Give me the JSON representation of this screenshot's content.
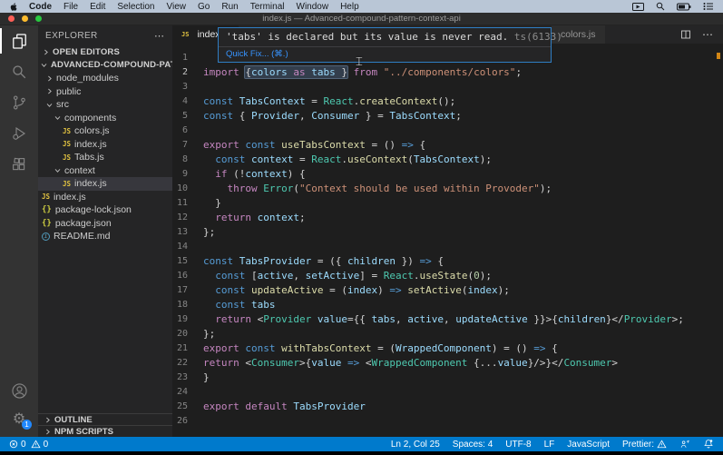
{
  "menubar": {
    "items": [
      "Code",
      "File",
      "Edit",
      "Selection",
      "View",
      "Go",
      "Run",
      "Terminal",
      "Window",
      "Help"
    ]
  },
  "window": {
    "title": "index.js — Advanced-compound-pattern-context-api"
  },
  "activity_bar": {
    "settings_badge": "1"
  },
  "sidebar": {
    "title": "EXPLORER",
    "more": "⋯",
    "open_editors_label": "OPEN EDITORS",
    "root_label": "ADVANCED-COMPOUND-PATTERN-C...",
    "tree": [
      {
        "label": "node_modules",
        "kind": "folder",
        "state": "collapsed",
        "depth": 1
      },
      {
        "label": "public",
        "kind": "folder",
        "state": "collapsed",
        "depth": 1
      },
      {
        "label": "src",
        "kind": "folder",
        "state": "expanded",
        "depth": 1
      },
      {
        "label": "components",
        "kind": "folder",
        "state": "expanded",
        "depth": 2
      },
      {
        "label": "colors.js",
        "kind": "js",
        "depth": 3
      },
      {
        "label": "index.js",
        "kind": "js",
        "depth": 3
      },
      {
        "label": "Tabs.js",
        "kind": "js",
        "depth": 3
      },
      {
        "label": "context",
        "kind": "folder",
        "state": "expanded",
        "depth": 2
      },
      {
        "label": "index.js",
        "kind": "js",
        "depth": 3,
        "selected": true
      },
      {
        "label": "index.js",
        "kind": "js",
        "depth": 1
      },
      {
        "label": "package-lock.json",
        "kind": "json",
        "depth": 1
      },
      {
        "label": "package.json",
        "kind": "json",
        "depth": 1
      },
      {
        "label": "README.md",
        "kind": "info",
        "depth": 1
      }
    ],
    "outline_label": "OUTLINE",
    "npm_label": "NPM SCRIPTS"
  },
  "editor": {
    "tabs": {
      "active": "index.js",
      "inactive": "colors.js"
    },
    "tooltip": {
      "message": "'tabs' is declared but its value is never read.",
      "code": "ts(6133)",
      "quick_fix": "Quick Fix... (⌘.)"
    },
    "lines": [
      {
        "n": 1,
        "tokens": []
      },
      {
        "n": 2,
        "active": true,
        "tokens": [
          [
            "k",
            "import "
          ],
          [
            "p",
            "{",
            "hl"
          ],
          [
            "v",
            "colors",
            "hl"
          ],
          [
            "k",
            " as ",
            "hl"
          ],
          [
            "v",
            "tabs",
            "hl"
          ],
          [
            "p",
            " }",
            "hl"
          ],
          [
            "k",
            " from "
          ],
          [
            "str",
            "\"../components/colors\""
          ],
          [
            "p",
            ";"
          ]
        ]
      },
      {
        "n": 3,
        "tokens": []
      },
      {
        "n": 4,
        "tokens": [
          [
            "s",
            "const "
          ],
          [
            "v",
            "TabsContext "
          ],
          [
            "p",
            "= "
          ],
          [
            "c",
            "React"
          ],
          [
            "p",
            "."
          ],
          [
            "f",
            "createContext"
          ],
          [
            "p",
            "();"
          ]
        ]
      },
      {
        "n": 5,
        "tokens": [
          [
            "s",
            "const "
          ],
          [
            "p",
            "{ "
          ],
          [
            "v",
            "Provider"
          ],
          [
            "p",
            ", "
          ],
          [
            "v",
            "Consumer"
          ],
          [
            "p",
            " } = "
          ],
          [
            "v",
            "TabsContext"
          ],
          [
            "p",
            ";"
          ]
        ]
      },
      {
        "n": 6,
        "tokens": []
      },
      {
        "n": 7,
        "tokens": [
          [
            "k",
            "export "
          ],
          [
            "s",
            "const "
          ],
          [
            "f",
            "useTabsContext "
          ],
          [
            "p",
            "= () "
          ],
          [
            "s",
            "=>"
          ],
          [
            "p",
            " {"
          ]
        ]
      },
      {
        "n": 8,
        "tokens": [
          [
            "p",
            "  "
          ],
          [
            "s",
            "const "
          ],
          [
            "v",
            "context "
          ],
          [
            "p",
            "= "
          ],
          [
            "c",
            "React"
          ],
          [
            "p",
            "."
          ],
          [
            "f",
            "useContext"
          ],
          [
            "p",
            "("
          ],
          [
            "v",
            "TabsContext"
          ],
          [
            "p",
            ");"
          ]
        ]
      },
      {
        "n": 9,
        "tokens": [
          [
            "p",
            "  "
          ],
          [
            "k",
            "if "
          ],
          [
            "p",
            "(!"
          ],
          [
            "v",
            "context"
          ],
          [
            "p",
            ") {"
          ]
        ]
      },
      {
        "n": 10,
        "tokens": [
          [
            "p",
            "    "
          ],
          [
            "k",
            "throw "
          ],
          [
            "c",
            "Error"
          ],
          [
            "p",
            "("
          ],
          [
            "str",
            "\"Context should be used within Provoder\""
          ],
          [
            "p",
            ");"
          ]
        ]
      },
      {
        "n": 11,
        "tokens": [
          [
            "p",
            "  }"
          ]
        ]
      },
      {
        "n": 12,
        "tokens": [
          [
            "p",
            "  "
          ],
          [
            "k",
            "return "
          ],
          [
            "v",
            "context"
          ],
          [
            "p",
            ";"
          ]
        ]
      },
      {
        "n": 13,
        "tokens": [
          [
            "p",
            "};"
          ]
        ]
      },
      {
        "n": 14,
        "tokens": []
      },
      {
        "n": 15,
        "tokens": [
          [
            "s",
            "const "
          ],
          [
            "v",
            "TabsProvider "
          ],
          [
            "p",
            "= ({ "
          ],
          [
            "v",
            "children"
          ],
          [
            "p",
            " }) "
          ],
          [
            "s",
            "=>"
          ],
          [
            "p",
            " {"
          ]
        ]
      },
      {
        "n": 16,
        "tokens": [
          [
            "p",
            "  "
          ],
          [
            "s",
            "const "
          ],
          [
            "p",
            "["
          ],
          [
            "v",
            "active"
          ],
          [
            "p",
            ", "
          ],
          [
            "v",
            "setActive"
          ],
          [
            "p",
            "] = "
          ],
          [
            "c",
            "React"
          ],
          [
            "p",
            "."
          ],
          [
            "f",
            "useState"
          ],
          [
            "p",
            "("
          ],
          [
            "n",
            "0"
          ],
          [
            "p",
            ");"
          ]
        ]
      },
      {
        "n": 17,
        "tokens": [
          [
            "p",
            "  "
          ],
          [
            "s",
            "const "
          ],
          [
            "f",
            "updateActive "
          ],
          [
            "p",
            "= ("
          ],
          [
            "v",
            "index"
          ],
          [
            "p",
            ") "
          ],
          [
            "s",
            "=>"
          ],
          [
            "p",
            " "
          ],
          [
            "f",
            "setActive"
          ],
          [
            "p",
            "("
          ],
          [
            "v",
            "index"
          ],
          [
            "p",
            ");"
          ]
        ]
      },
      {
        "n": 18,
        "tokens": [
          [
            "p",
            "  "
          ],
          [
            "s",
            "const "
          ],
          [
            "v",
            "tabs"
          ]
        ]
      },
      {
        "n": 19,
        "tokens": [
          [
            "p",
            "  "
          ],
          [
            "k",
            "return "
          ],
          [
            "p",
            "<"
          ],
          [
            "c",
            "Provider"
          ],
          [
            "p",
            " "
          ],
          [
            "v",
            "value"
          ],
          [
            "p",
            "={{ "
          ],
          [
            "v",
            "tabs"
          ],
          [
            "p",
            ", "
          ],
          [
            "v",
            "active"
          ],
          [
            "p",
            ", "
          ],
          [
            "v",
            "updateActive"
          ],
          [
            "p",
            " }}>{"
          ],
          [
            "v",
            "children"
          ],
          [
            "p",
            "}</"
          ],
          [
            "c",
            "Provider"
          ],
          [
            "p",
            ">;"
          ]
        ]
      },
      {
        "n": 20,
        "tokens": [
          [
            "p",
            "};"
          ]
        ]
      },
      {
        "n": 21,
        "tokens": [
          [
            "k",
            "export "
          ],
          [
            "s",
            "const "
          ],
          [
            "f",
            "withTabsContext "
          ],
          [
            "p",
            "= ("
          ],
          [
            "v",
            "WrappedComponent"
          ],
          [
            "p",
            ") = () "
          ],
          [
            "s",
            "=>"
          ],
          [
            "p",
            " {"
          ]
        ]
      },
      {
        "n": 22,
        "tokens": [
          [
            "k",
            "return "
          ],
          [
            "p",
            "<"
          ],
          [
            "c",
            "Consumer"
          ],
          [
            "p",
            ">{"
          ],
          [
            "v",
            "value"
          ],
          [
            "p",
            " "
          ],
          [
            "s",
            "=>"
          ],
          [
            "p",
            " <"
          ],
          [
            "c",
            "WrappedComponent"
          ],
          [
            "p",
            " {..."
          ],
          [
            "v",
            "value"
          ],
          [
            "p",
            "}/>}</"
          ],
          [
            "c",
            "Consumer"
          ],
          [
            "p",
            ">"
          ]
        ]
      },
      {
        "n": 23,
        "tokens": [
          [
            "p",
            "}"
          ]
        ]
      },
      {
        "n": 24,
        "tokens": []
      },
      {
        "n": 25,
        "tokens": [
          [
            "k",
            "export "
          ],
          [
            "k",
            "default "
          ],
          [
            "v",
            "TabsProvider"
          ]
        ]
      },
      {
        "n": 26,
        "tokens": []
      }
    ]
  },
  "status_bar": {
    "errors": "0",
    "warnings": "0",
    "line_col": "Ln 2, Col 25",
    "indent": "Spaces: 4",
    "encoding": "UTF-8",
    "eol": "LF",
    "language": "JavaScript",
    "prettier": "Prettier:"
  },
  "colors": {
    "accent": "#007acc",
    "menubar_bg": "#b9c6d6",
    "titlebar_bg": "#2c2c2c",
    "activitybar_bg": "#333333",
    "sidebar_bg": "#252526",
    "editor_bg": "#1e1e1e",
    "tooltip_border": "#2f7ec4",
    "selection_highlight": "#567498",
    "warning_marker": "#d18616"
  }
}
